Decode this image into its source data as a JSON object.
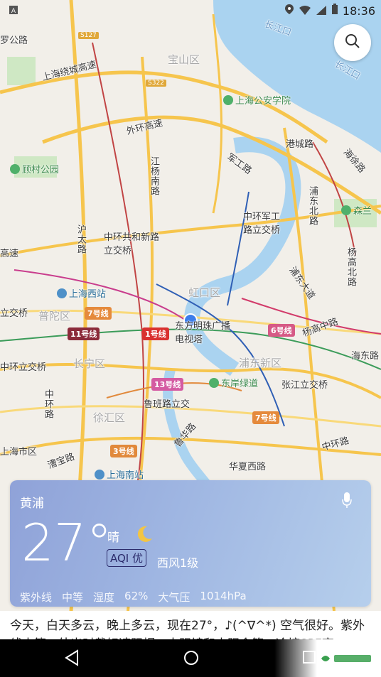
{
  "status": {
    "time": "18:36"
  },
  "map": {
    "districts": [
      "宝山区",
      "虹口区",
      "普陀区",
      "长宁区",
      "浦东新区",
      "徐汇区"
    ],
    "water": [
      "长江口",
      "长江口"
    ],
    "roads": [
      "罗公路",
      "上海绕城高速",
      "外环高速",
      "沪太路",
      "中环共和新路立交桥",
      "高速",
      "立交桥",
      "中环立交桥",
      "中环路",
      "漕宝路",
      "军工路",
      "中环军工路立交桥",
      "港城路",
      "浦东北路",
      "海徐路",
      "杨高北路",
      "杨高中路",
      "张江立交桥",
      "中环路",
      "华夏西路",
      "鲁班路立交",
      "上海市区",
      "海东路",
      "浦东大道",
      "江杨南路",
      "鲁华路",
      "东方明珠广播电视塔"
    ],
    "pois": [
      "上海公安学院",
      "顾村公园",
      "上海西站",
      "东岸绿道",
      "上海南站",
      "森兰"
    ],
    "metro": [
      "11号线",
      "7号线",
      "1号线",
      "13号线",
      "6号线",
      "3号线",
      "7号线"
    ],
    "shields": [
      "S127",
      "S322"
    ]
  },
  "weather": {
    "city": "黄浦",
    "temp": "27°",
    "cond": "晴",
    "aqi": "AQI 优",
    "wind": "西风1级",
    "details": [
      "紫外线",
      "中等",
      "湿度",
      "62%",
      "大气压",
      "1014hPa"
    ]
  },
  "description": "今天，白天多云，晚上多云，现在27°，♪(^∇^*) 空气很好。紫外线中等，外出时戴好遮阳帽，太阳镜和太阳伞等；冷塘SPF高"
}
